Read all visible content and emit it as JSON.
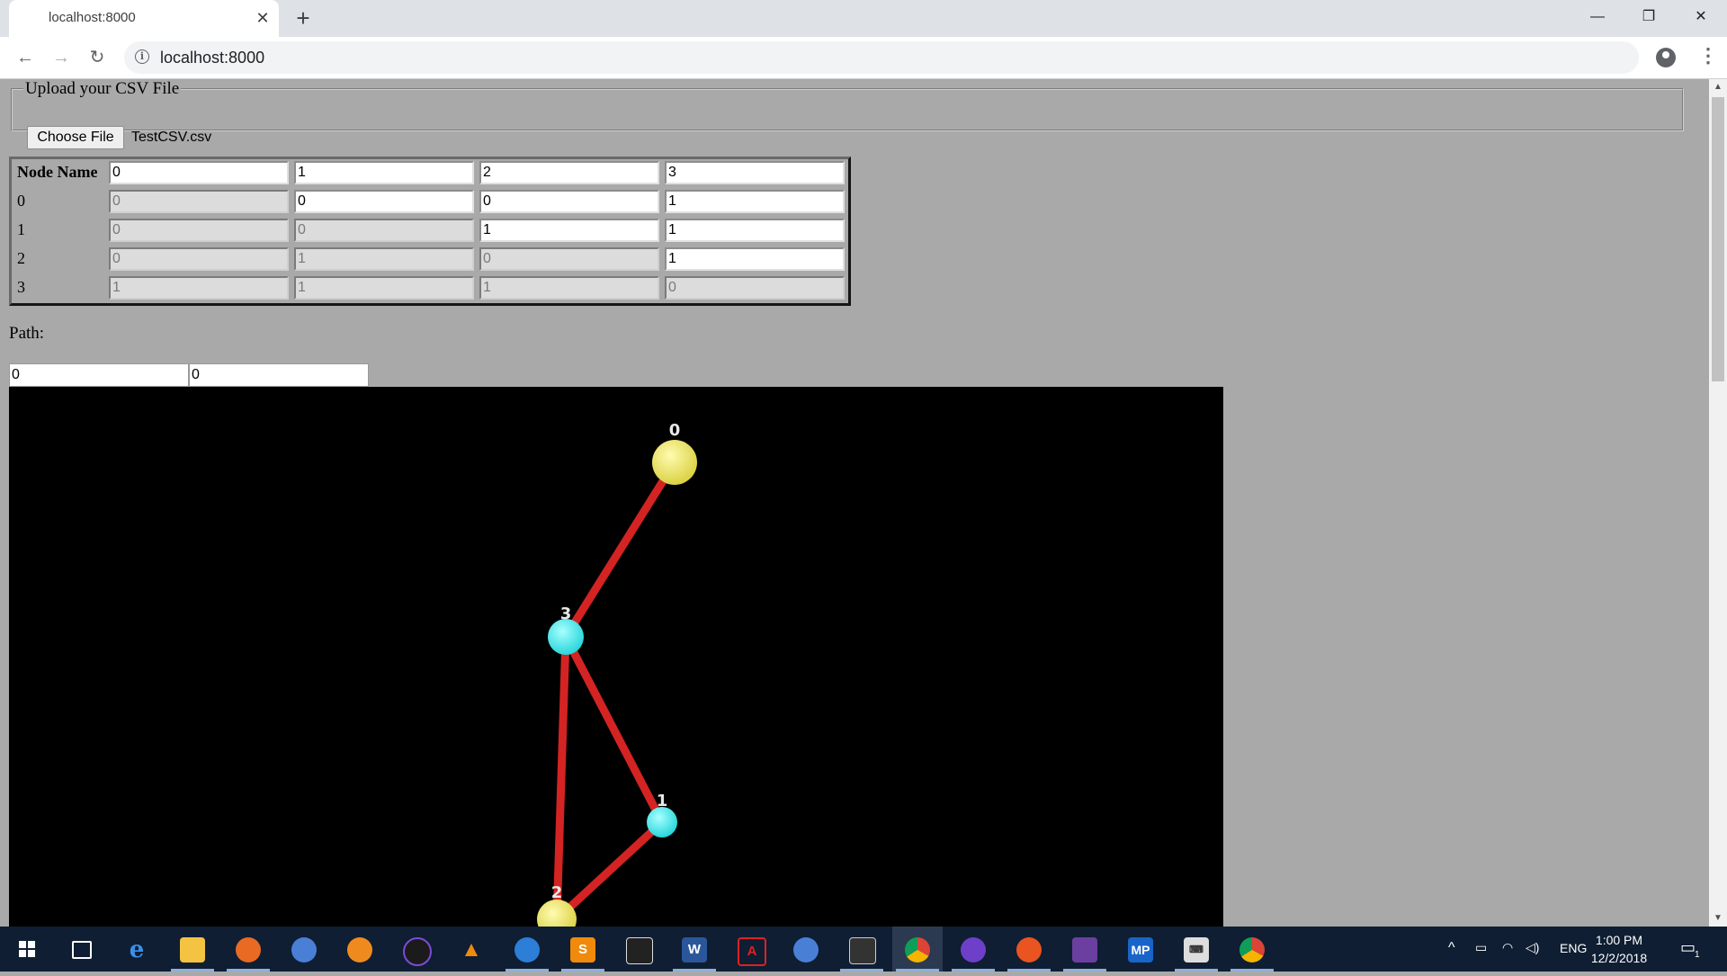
{
  "browser": {
    "tab_title": "localhost:8000",
    "url": "localhost:8000"
  },
  "upload": {
    "legend": "Upload your CSV File",
    "button_label": "Choose File",
    "file_name": "TestCSV.csv"
  },
  "matrix": {
    "header_label": "Node Name",
    "column_headers": [
      "0",
      "1",
      "2",
      "3"
    ],
    "rows": [
      {
        "label": "0",
        "cells": [
          {
            "value": "0",
            "editable": false
          },
          {
            "value": "0",
            "editable": true
          },
          {
            "value": "0",
            "editable": true
          },
          {
            "value": "1",
            "editable": true
          }
        ]
      },
      {
        "label": "1",
        "cells": [
          {
            "value": "0",
            "editable": false
          },
          {
            "value": "0",
            "editable": false
          },
          {
            "value": "1",
            "editable": true
          },
          {
            "value": "1",
            "editable": true
          }
        ]
      },
      {
        "label": "2",
        "cells": [
          {
            "value": "0",
            "editable": false
          },
          {
            "value": "1",
            "editable": false
          },
          {
            "value": "0",
            "editable": false
          },
          {
            "value": "1",
            "editable": true
          }
        ]
      },
      {
        "label": "3",
        "cells": [
          {
            "value": "1",
            "editable": false
          },
          {
            "value": "1",
            "editable": false
          },
          {
            "value": "1",
            "editable": false
          },
          {
            "value": "0",
            "editable": false
          }
        ]
      }
    ]
  },
  "path": {
    "label": "Path:",
    "inputs": [
      "0",
      "0"
    ]
  },
  "graph": {
    "nodes": [
      {
        "id": "0",
        "color": "#e8e066"
      },
      {
        "id": "3",
        "color": "#33e6e6"
      },
      {
        "id": "1",
        "color": "#33e6e6"
      },
      {
        "id": "2",
        "color": "#e8e066"
      }
    ],
    "edges": [
      [
        "0",
        "3"
      ],
      [
        "3",
        "1"
      ],
      [
        "3",
        "2"
      ],
      [
        "1",
        "2"
      ]
    ],
    "edge_color": "#d42323"
  },
  "taskbar": {
    "apps": [
      "start-icon",
      "task-view-icon",
      "edge-icon",
      "file-explorer-icon",
      "firefox-icon",
      "chromium-icon",
      "orange-app-icon",
      "media-app-icon",
      "vlc-icon",
      "internet-explorer-icon",
      "sublime-text-icon",
      "video-editor-icon",
      "word-icon",
      "acrobat-icon",
      "chromium-2-icon",
      "snipping-tool-icon",
      "chrome-icon",
      "github-desktop-icon",
      "ubuntu-icon",
      "winrar-icon",
      "mp-app-icon",
      "remote-desktop-icon",
      "chrome-2-icon"
    ],
    "language": "ENG",
    "time": "1:00 PM",
    "date": "12/2/2018",
    "notification_count": "1"
  }
}
